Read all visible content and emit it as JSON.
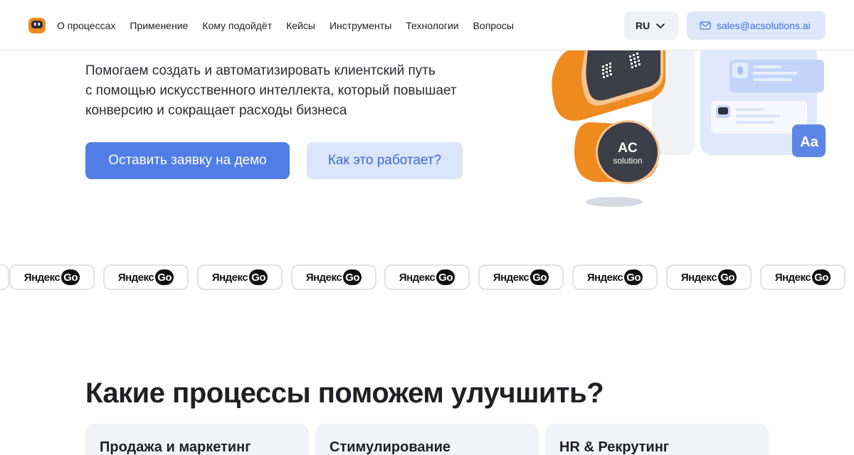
{
  "header": {
    "nav": [
      "О процессах",
      "Применение",
      "Кому подойдёт",
      "Кейсы",
      "Инструменты",
      "Технологии",
      "Вопросы"
    ],
    "lang": "RU",
    "email": "sales@acsolutions.ai"
  },
  "hero": {
    "lines": [
      "Помогаем создать и автоматизировать клиентский путь",
      "с помощью искусственного интеллекта, который повышает",
      "конверсию и сокращает расходы бизнеса"
    ],
    "primary_button": "Оставить заявку на демо",
    "secondary_button": "Как это работает?",
    "robot_badge": {
      "title": "AC",
      "subtitle": "solution"
    },
    "font_badge": "Aa"
  },
  "partners": {
    "logo_text": "Яндекс",
    "logo_suffix": "Go"
  },
  "section": {
    "title": "Какие процессы поможем улучшить?",
    "cards": [
      "Продажа и маркетинг",
      "Стимулирование",
      "HR & Рекрутинг"
    ]
  },
  "colors": {
    "accent": "#507ee6",
    "accent_light": "#dbe5fb",
    "robot_orange": "#ef8a1f",
    "robot_dark": "#3c3e48"
  }
}
